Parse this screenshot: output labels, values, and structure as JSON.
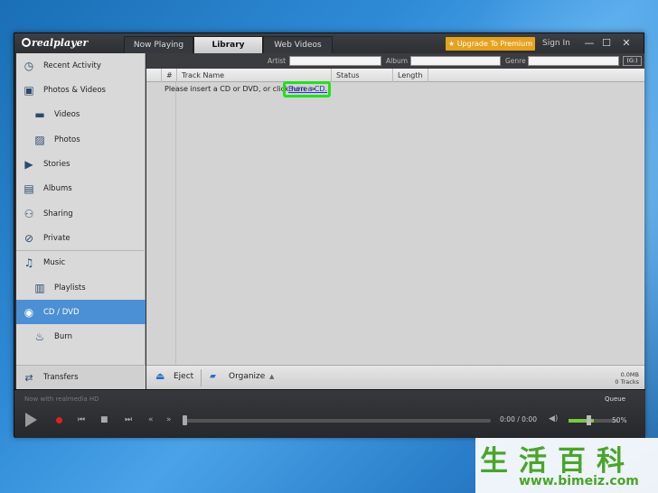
{
  "tabs": [
    {
      "label": "Now Playing"
    },
    {
      "label": "Library"
    },
    {
      "label": "Web Videos"
    }
  ],
  "header": {
    "logo_text": "realplayer",
    "upgrade_label": "★ Upgrade To Premium",
    "sign_in_label": "Sign In",
    "minimize": "—",
    "maximize": "☐",
    "close": "✕"
  },
  "sidebar": {
    "items": [
      {
        "label": "Recent Activity",
        "icon": "clock-icon"
      },
      {
        "label": "Photos & Videos",
        "icon": "photos-videos-icon"
      },
      {
        "label": "Videos",
        "icon": "film-icon"
      },
      {
        "label": "Photos",
        "icon": "photo-icon"
      },
      {
        "label": "Stories",
        "icon": "stories-icon"
      },
      {
        "label": "Albums",
        "icon": "album-icon"
      },
      {
        "label": "Sharing",
        "icon": "people-icon"
      },
      {
        "label": "Private",
        "icon": "eye-slash-icon"
      },
      {
        "label": "Music",
        "icon": "music-note-icon"
      },
      {
        "label": "Playlists",
        "icon": "playlist-icon"
      },
      {
        "label": "CD / DVD",
        "icon": "disc-icon"
      },
      {
        "label": "Burn",
        "icon": "burn-icon"
      }
    ],
    "selected": "CD / DVD",
    "transfers_label": "Transfers"
  },
  "filters": {
    "artist_label": "Artist",
    "album_label": "Album",
    "genre_label": "Genre",
    "drive_label": "(G:)"
  },
  "table": {
    "columns": [
      "#",
      "Track Name",
      "Status",
      "Length"
    ]
  },
  "main": {
    "message": "Please insert a CD or DVD, or click here >",
    "burn_link": "Burn a CD."
  },
  "actions": {
    "eject_label": "Eject",
    "organize_label": "Organize",
    "size": "0.0MB",
    "tracks": "0 Tracks"
  },
  "player": {
    "now_with": "Now with realmedia HD",
    "queue_label": "Queue",
    "time": "0:00 / 0:00",
    "volume_label": "50%",
    "volume": 50
  },
  "watermark": {
    "chinese": "生活百科",
    "url": "www.bimeiz.com"
  },
  "colors": {
    "selected": "#4b8fd4",
    "highlight": "#22e01e",
    "upgrade": "#e6a21e",
    "link": "#1a33c9"
  }
}
